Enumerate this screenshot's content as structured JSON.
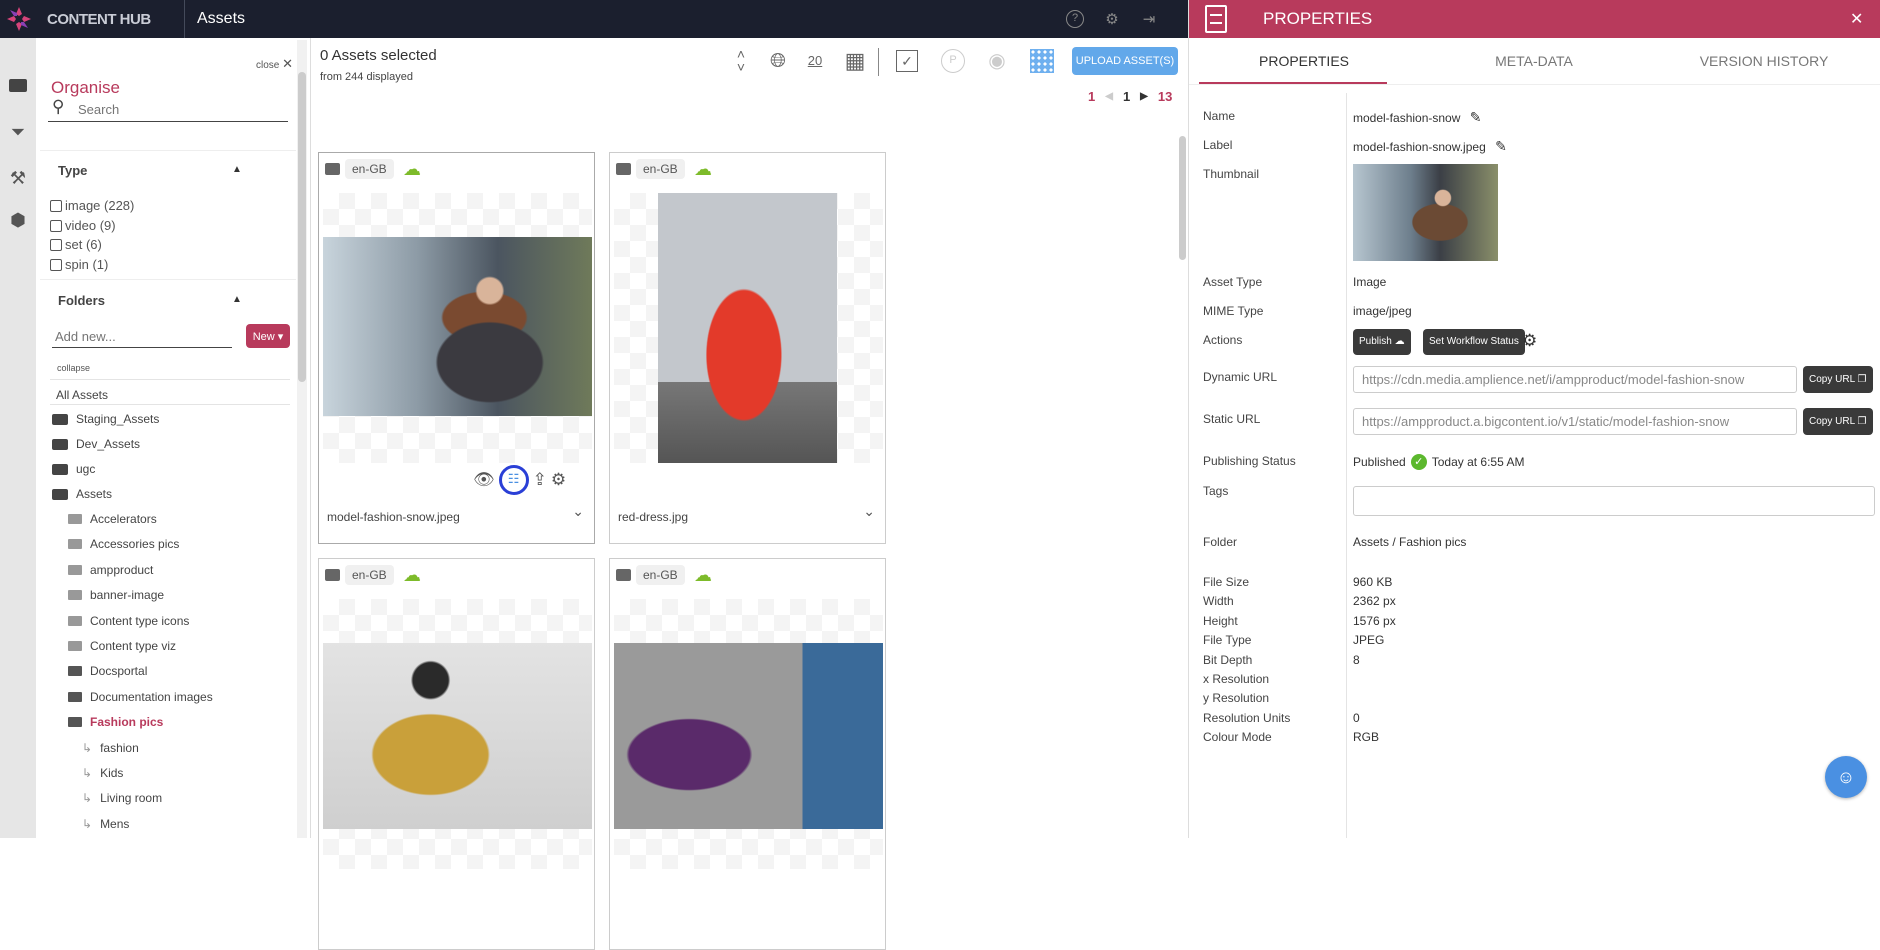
{
  "header": {
    "brand": "CONTENT HUB",
    "title": "Assets",
    "icons": [
      "help-icon",
      "settings-icon",
      "logout-icon"
    ]
  },
  "rail": {
    "icons": [
      "folder-icon",
      "filter-icon",
      "tools-icon",
      "box-icon"
    ]
  },
  "sidebar": {
    "close_label": "close",
    "title": "Organise",
    "search_placeholder": "Search",
    "type_header": "Type",
    "types": [
      {
        "label": "image (228)"
      },
      {
        "label": "video (9)"
      },
      {
        "label": "set (6)"
      },
      {
        "label": "spin (1)"
      }
    ],
    "folders_header": "Folders",
    "add_placeholder": "Add new...",
    "new_button": "New",
    "collapse": "collapse",
    "all_assets": "All Assets",
    "roots": [
      "Staging_Assets",
      "Dev_Assets",
      "ugc",
      "Assets"
    ],
    "folders": [
      {
        "label": "Accelerators",
        "dark": false
      },
      {
        "label": "Accessories pics",
        "dark": false
      },
      {
        "label": "ampproduct",
        "dark": false
      },
      {
        "label": "banner-image",
        "dark": false
      },
      {
        "label": "Content type icons",
        "dark": false
      },
      {
        "label": "Content type viz",
        "dark": false
      },
      {
        "label": "Docsportal",
        "dark": true
      },
      {
        "label": "Documentation images",
        "dark": true
      },
      {
        "label": "Fashion pics",
        "dark": true,
        "active": true
      }
    ],
    "subfolders": [
      "fashion",
      "Kids",
      "Living room",
      "Mens"
    ],
    "accent": "#b83a5c"
  },
  "main": {
    "selected": "0 Assets selected",
    "displayed": "from 244 displayed",
    "per_page": "20",
    "upload": "UPLOAD ASSET(S)",
    "pagination": {
      "first": "1",
      "current": "1",
      "last": "13"
    },
    "cards": [
      {
        "locale": "en-GB",
        "name": "model-fashion-snow.jpeg"
      },
      {
        "locale": "en-GB",
        "name": "red-dress.jpg"
      },
      {
        "locale": "en-GB",
        "name": ""
      },
      {
        "locale": "en-GB",
        "name": ""
      }
    ]
  },
  "properties": {
    "title": "PROPERTIES",
    "tabs": [
      "PROPERTIES",
      "META-DATA",
      "VERSION HISTORY"
    ],
    "active_tab": 0,
    "labels": {
      "name": "Name",
      "label": "Label",
      "thumbnail": "Thumbnail",
      "asset_type": "Asset Type",
      "mime": "MIME Type",
      "actions": "Actions",
      "dynamic_url": "Dynamic URL",
      "static_url": "Static URL",
      "pub_status": "Publishing Status",
      "tags": "Tags",
      "folder": "Folder"
    },
    "values": {
      "name": "model-fashion-snow",
      "label": "model-fashion-snow.jpeg",
      "asset_type": "Image",
      "mime": "image/jpeg",
      "dynamic_url": "https://cdn.media.amplience.net/i/ampproduct/model-fashion-snow",
      "static_url": "https://ampproduct.a.bigcontent.io/v1/static/model-fashion-snow",
      "pub_status": "Published",
      "pub_time": "Today at 6:55 AM",
      "tags": "",
      "folder": "Assets / Fashion pics"
    },
    "publish_btn": "Publish",
    "workflow_btn": "Set Workflow Status",
    "copy_btn": "Copy URL",
    "details": [
      {
        "k": "File Size",
        "v": "960 KB"
      },
      {
        "k": "Width",
        "v": "2362 px"
      },
      {
        "k": "Height",
        "v": "1576 px"
      },
      {
        "k": "File Type",
        "v": "JPEG"
      },
      {
        "k": "Bit Depth",
        "v": "8"
      },
      {
        "k": "x Resolution",
        "v": ""
      },
      {
        "k": "y Resolution",
        "v": ""
      },
      {
        "k": "Resolution Units",
        "v": "0"
      },
      {
        "k": "Colour Mode",
        "v": "RGB"
      }
    ]
  }
}
